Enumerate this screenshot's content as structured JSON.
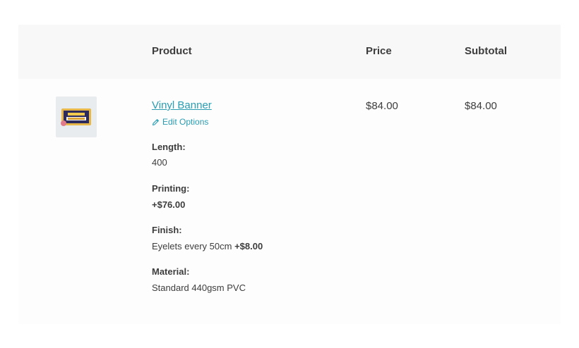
{
  "colors": {
    "link": "#2a9db3",
    "text": "#3d3d3d",
    "header_bg": "#f8f8f8",
    "row_bg": "#fdfdfd"
  },
  "header": {
    "product": "Product",
    "price": "Price",
    "subtotal": "Subtotal"
  },
  "item": {
    "thumbnail_icon": "vinyl-banner-thumbnail",
    "name": "Vinyl Banner",
    "edit_label": "Edit Options",
    "edit_icon": "pencil-icon",
    "price": "$84.00",
    "subtotal": "$84.00",
    "meta": {
      "length_label": "Length:",
      "length_value": "400",
      "printing_label": "Printing:",
      "printing_value": "+$76.00",
      "finish_label": "Finish:",
      "finish_value": "Eyelets every 50cm",
      "finish_price": "+$8.00",
      "material_label": "Material:",
      "material_value": "Standard 440gsm PVC"
    }
  }
}
